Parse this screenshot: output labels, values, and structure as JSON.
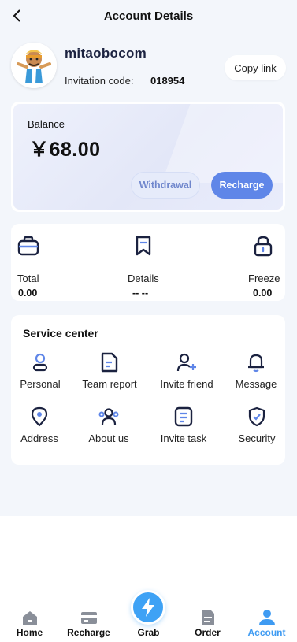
{
  "header": {
    "title": "Account Details"
  },
  "profile": {
    "username": "mitaobocom",
    "invite_label": "Invitation code:",
    "invite_code": "018954",
    "copy_label": "Copy link"
  },
  "balance": {
    "label": "Balance",
    "amount": "￥68.00",
    "withdraw_label": "Withdrawal",
    "recharge_label": "Recharge"
  },
  "stats": [
    {
      "label": "Total",
      "value": "0.00",
      "icon": "wallet-icon"
    },
    {
      "label": "Details",
      "value": "-- --",
      "icon": "bookmark-icon"
    },
    {
      "label": "Freeze",
      "value": "0.00",
      "icon": "lock-icon"
    }
  ],
  "service": {
    "title": "Service center",
    "items": [
      {
        "label": "Personal",
        "icon": "person-icon"
      },
      {
        "label": "Team report",
        "icon": "document-icon"
      },
      {
        "label": "Invite friend",
        "icon": "add-user-icon"
      },
      {
        "label": "Message",
        "icon": "bell-icon"
      },
      {
        "label": "Address",
        "icon": "location-pin-icon"
      },
      {
        "label": "About us",
        "icon": "team-icon"
      },
      {
        "label": "Invite task",
        "icon": "task-list-icon"
      },
      {
        "label": "Security",
        "icon": "shield-check-icon"
      }
    ]
  },
  "nav": {
    "items": [
      {
        "label": "Home",
        "icon": "home-icon"
      },
      {
        "label": "Recharge",
        "icon": "card-icon"
      },
      {
        "label": "Grab",
        "icon": "lightning-icon"
      },
      {
        "label": "Order",
        "icon": "order-icon"
      },
      {
        "label": "Account",
        "icon": "account-icon"
      }
    ],
    "active": "Account"
  },
  "colors": {
    "accent": "#5f86e8",
    "nav_active": "#3f9bf2",
    "page_bg": "#f3f6fb"
  }
}
